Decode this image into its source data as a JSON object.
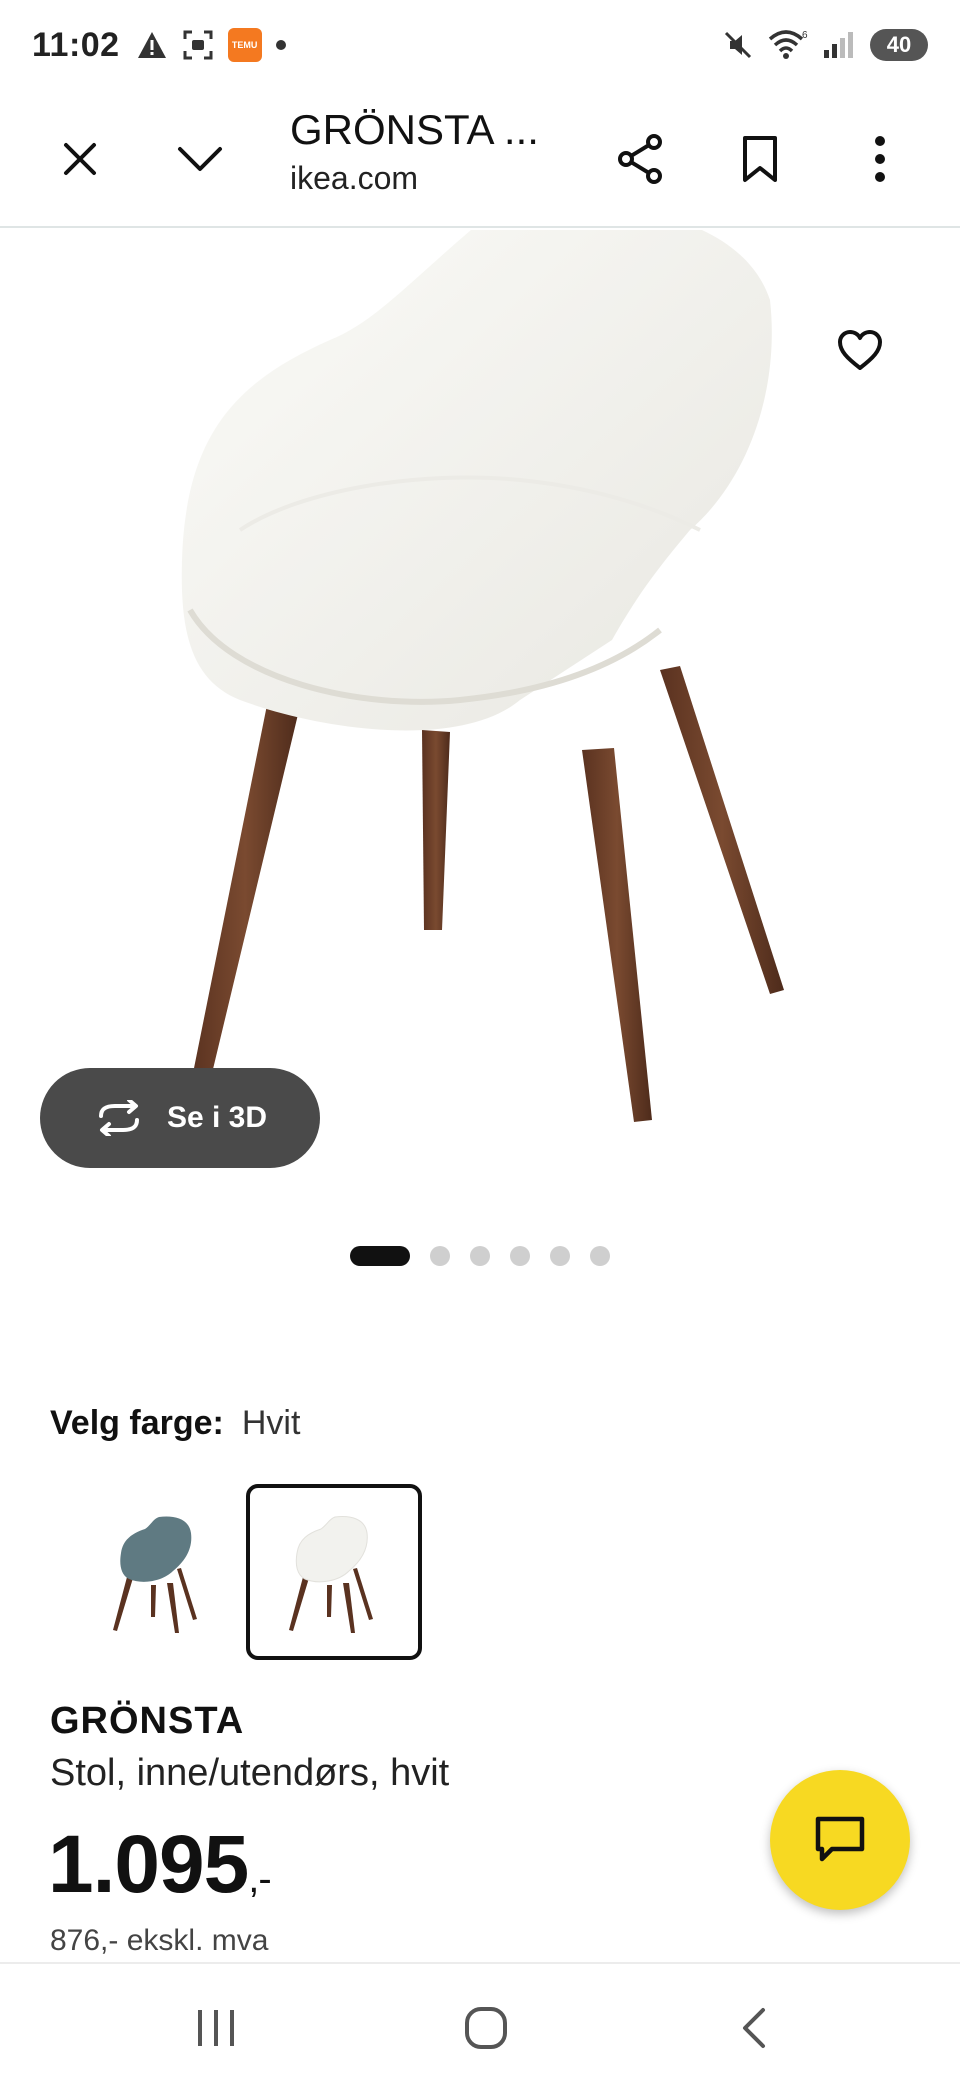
{
  "status_bar": {
    "time": "11:02",
    "temu_badge": "TEMU",
    "battery": "40"
  },
  "toolbar": {
    "title": "GRÖNSTA ...",
    "url": "ikea.com"
  },
  "product": {
    "view_3d_label": "Se i 3D",
    "carousel": {
      "total": 6,
      "active_index": 0
    },
    "color_label": "Velg farge:",
    "color_value": "Hvit",
    "swatches": [
      {
        "name": "Blågrå",
        "color": "#5f7a82",
        "selected": false
      },
      {
        "name": "Hvit",
        "color": "#f2f2ee",
        "selected": true
      }
    ],
    "name": "GRÖNSTA",
    "description": "Stol, inne/utendørs, hvit",
    "price": "1.095",
    "price_suffix": ",-",
    "price_ex_vat": "876,- ekskl. mva"
  },
  "colors": {
    "chat_fab": "#f7d922",
    "chair_shell": "#f4f3ee",
    "chair_legs": "#6b3e26"
  },
  "icons": {
    "close": "close-icon",
    "collapse": "chevron-down-icon",
    "share": "share-icon",
    "bookmark": "bookmark-icon",
    "menu": "more-vert-icon",
    "favorite": "heart-icon",
    "rotate": "rotate-3d-icon",
    "chat": "chat-icon"
  }
}
